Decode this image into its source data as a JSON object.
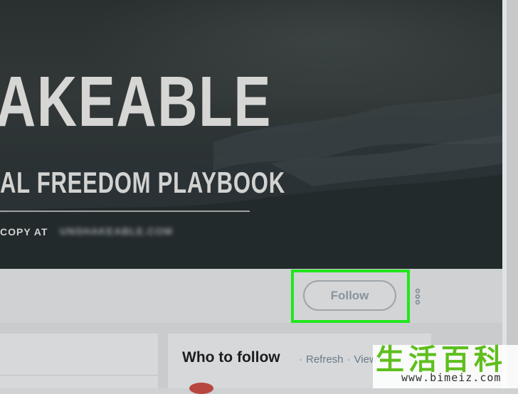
{
  "banner": {
    "title": "AKEABLE",
    "subtitle": "AL FREEDOM PLAYBOOK",
    "copy_text": "COPY AT",
    "blurred_url": "UNSHAKEABLE.COM"
  },
  "profile_nav": {
    "follow_label": "Follow",
    "more_icon": "vertical-ellipsis-icon",
    "highlight_color": "#21e61c"
  },
  "who_to_follow": {
    "title": "Who to follow",
    "refresh_label": "Refresh",
    "view_all_label": "View a"
  },
  "watermark": {
    "logo_text": "生活百科",
    "url": "www.bimeiz.com"
  }
}
